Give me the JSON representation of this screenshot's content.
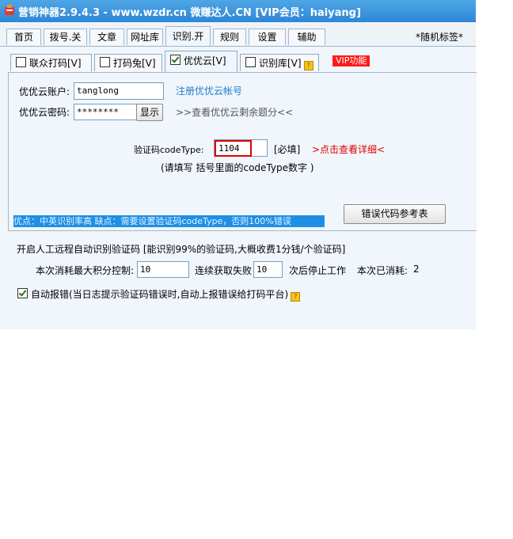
{
  "titlebar": {
    "title": "营销神器2.9.4.3 - www.wzdr.cn 微赚达人.CN [VIP会员：haiyang]"
  },
  "main_tabs": [
    {
      "label": "首页"
    },
    {
      "label": "拨号.关"
    },
    {
      "label": "文章"
    },
    {
      "label": "网址库"
    },
    {
      "label": "识别.开"
    },
    {
      "label": "规则"
    },
    {
      "label": "设置"
    },
    {
      "label": "辅助"
    }
  ],
  "random_tag": "*随机标签*",
  "sub_tabs": [
    {
      "label": "联众打码[V]",
      "checked": false
    },
    {
      "label": "打码兔[V]",
      "checked": false
    },
    {
      "label": "优优云[V]",
      "checked": true
    },
    {
      "label": "识别库[V]",
      "checked": false
    }
  ],
  "vip_label": "VIP功能",
  "account": {
    "account_label": "优优云账户:",
    "account_value": "tanglong",
    "register_link": "注册优优云帐号",
    "password_label": "优优云密码:",
    "password_value": "********",
    "show_button": "显示",
    "balance_link": ">>查看优优云剩余题分<<"
  },
  "codetype": {
    "label": "验证码codeType:",
    "value": "1104",
    "required": "[必填]",
    "detail_link": ">点击查看详细<",
    "hint": "(请填写 括号里面的codeType数字 )"
  },
  "banner": "优点：中英识别率高 缺点：需要设置验证码codeType，否则100%错误",
  "error_ref_button": "错误代码参考表",
  "manual": {
    "heading": "开启人工远程自动识别验证码 [能识别99%的验证码,大概收费1分钱/个验证码]",
    "max_points_label": "本次消耗最大积分控制:",
    "max_points_value": "10",
    "fail_label": "连续获取失败",
    "fail_value": "10",
    "stop_label": "次后停止工作",
    "consumed_label": "本次已消耗:",
    "consumed_value": "2"
  },
  "auto_report": {
    "checked": true,
    "label": "自动报错(当日志提示验证码错误时,自动上报错误给打码平台)"
  },
  "colors": {
    "titlebar": "#2d86d6",
    "link": "#1e7bd0",
    "red": "#e00000",
    "banner": "#1e8fe6"
  }
}
